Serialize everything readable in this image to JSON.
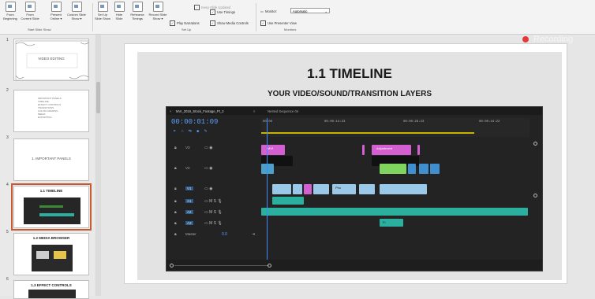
{
  "ribbon": {
    "buttons": [
      {
        "label": "From\nBeginning"
      },
      {
        "label": "From\nCurrent Slide"
      },
      {
        "label": "Present\nOnline ▾"
      },
      {
        "label": "Custom Slide\nShow ▾"
      },
      {
        "label": "Set Up\nSlide Show"
      },
      {
        "label": "Hide\nSlide"
      },
      {
        "label": "Rehearse\nTimings"
      },
      {
        "label": "Record Slide\nShow ▾"
      }
    ],
    "group_start": "Start Slide Show",
    "group_setup": "Set Up",
    "group_monitors": "Monitors",
    "checks": {
      "play_narrations": "Play Narrations",
      "use_timings": "Use Timings",
      "show_media_controls": "Show Media Controls",
      "keep_slide_updated": "Keep Slide Updated",
      "monitor_label": "Monitor:",
      "monitor_value": "Automatic",
      "presenter_view": "Use Presenter View"
    }
  },
  "record_button": {
    "label": "Recording",
    "color": "#e2393b"
  },
  "slides": [
    {
      "num": "1",
      "title": "VIDEO EDITING"
    },
    {
      "num": "2",
      "lines": [
        "IMPORTANT PANELS",
        "TIMELINE",
        "EFFECT CONTROLS",
        "TRANSITIONS",
        "COLOR GRADING",
        "MEDIA",
        "EXPORTING"
      ]
    },
    {
      "num": "3",
      "title": "1. IMPORTANT PANELS"
    },
    {
      "num": "4",
      "title": "1.1 TIMELINE"
    },
    {
      "num": "5",
      "title": "1.2 MEDIA BROWSER"
    },
    {
      "num": "6",
      "title": "1.3 EFFECT CONTROLS"
    }
  ],
  "slide": {
    "title": "1.1 TIMELINE",
    "subtitle": "YOUR VIDEO/SOUND/TRANSITION LAYERS"
  },
  "premiere": {
    "tab_active": "MVI_2016_Stock_Footage_Pt_2",
    "tab_other": "Nested Sequence 04",
    "timecode": "00:00:01:09",
    "ruler": [
      "00:00",
      "00:00:14:23",
      "00:00:29:23",
      "00:00:44:22"
    ],
    "tracks": [
      "V3",
      "V2",
      "V1",
      "A1",
      "A2",
      "A3"
    ],
    "master": "Master",
    "master_value": "0.0",
    "clip_labels": [
      "MVI",
      "Adjustment",
      "Pho",
      "Fr"
    ]
  }
}
